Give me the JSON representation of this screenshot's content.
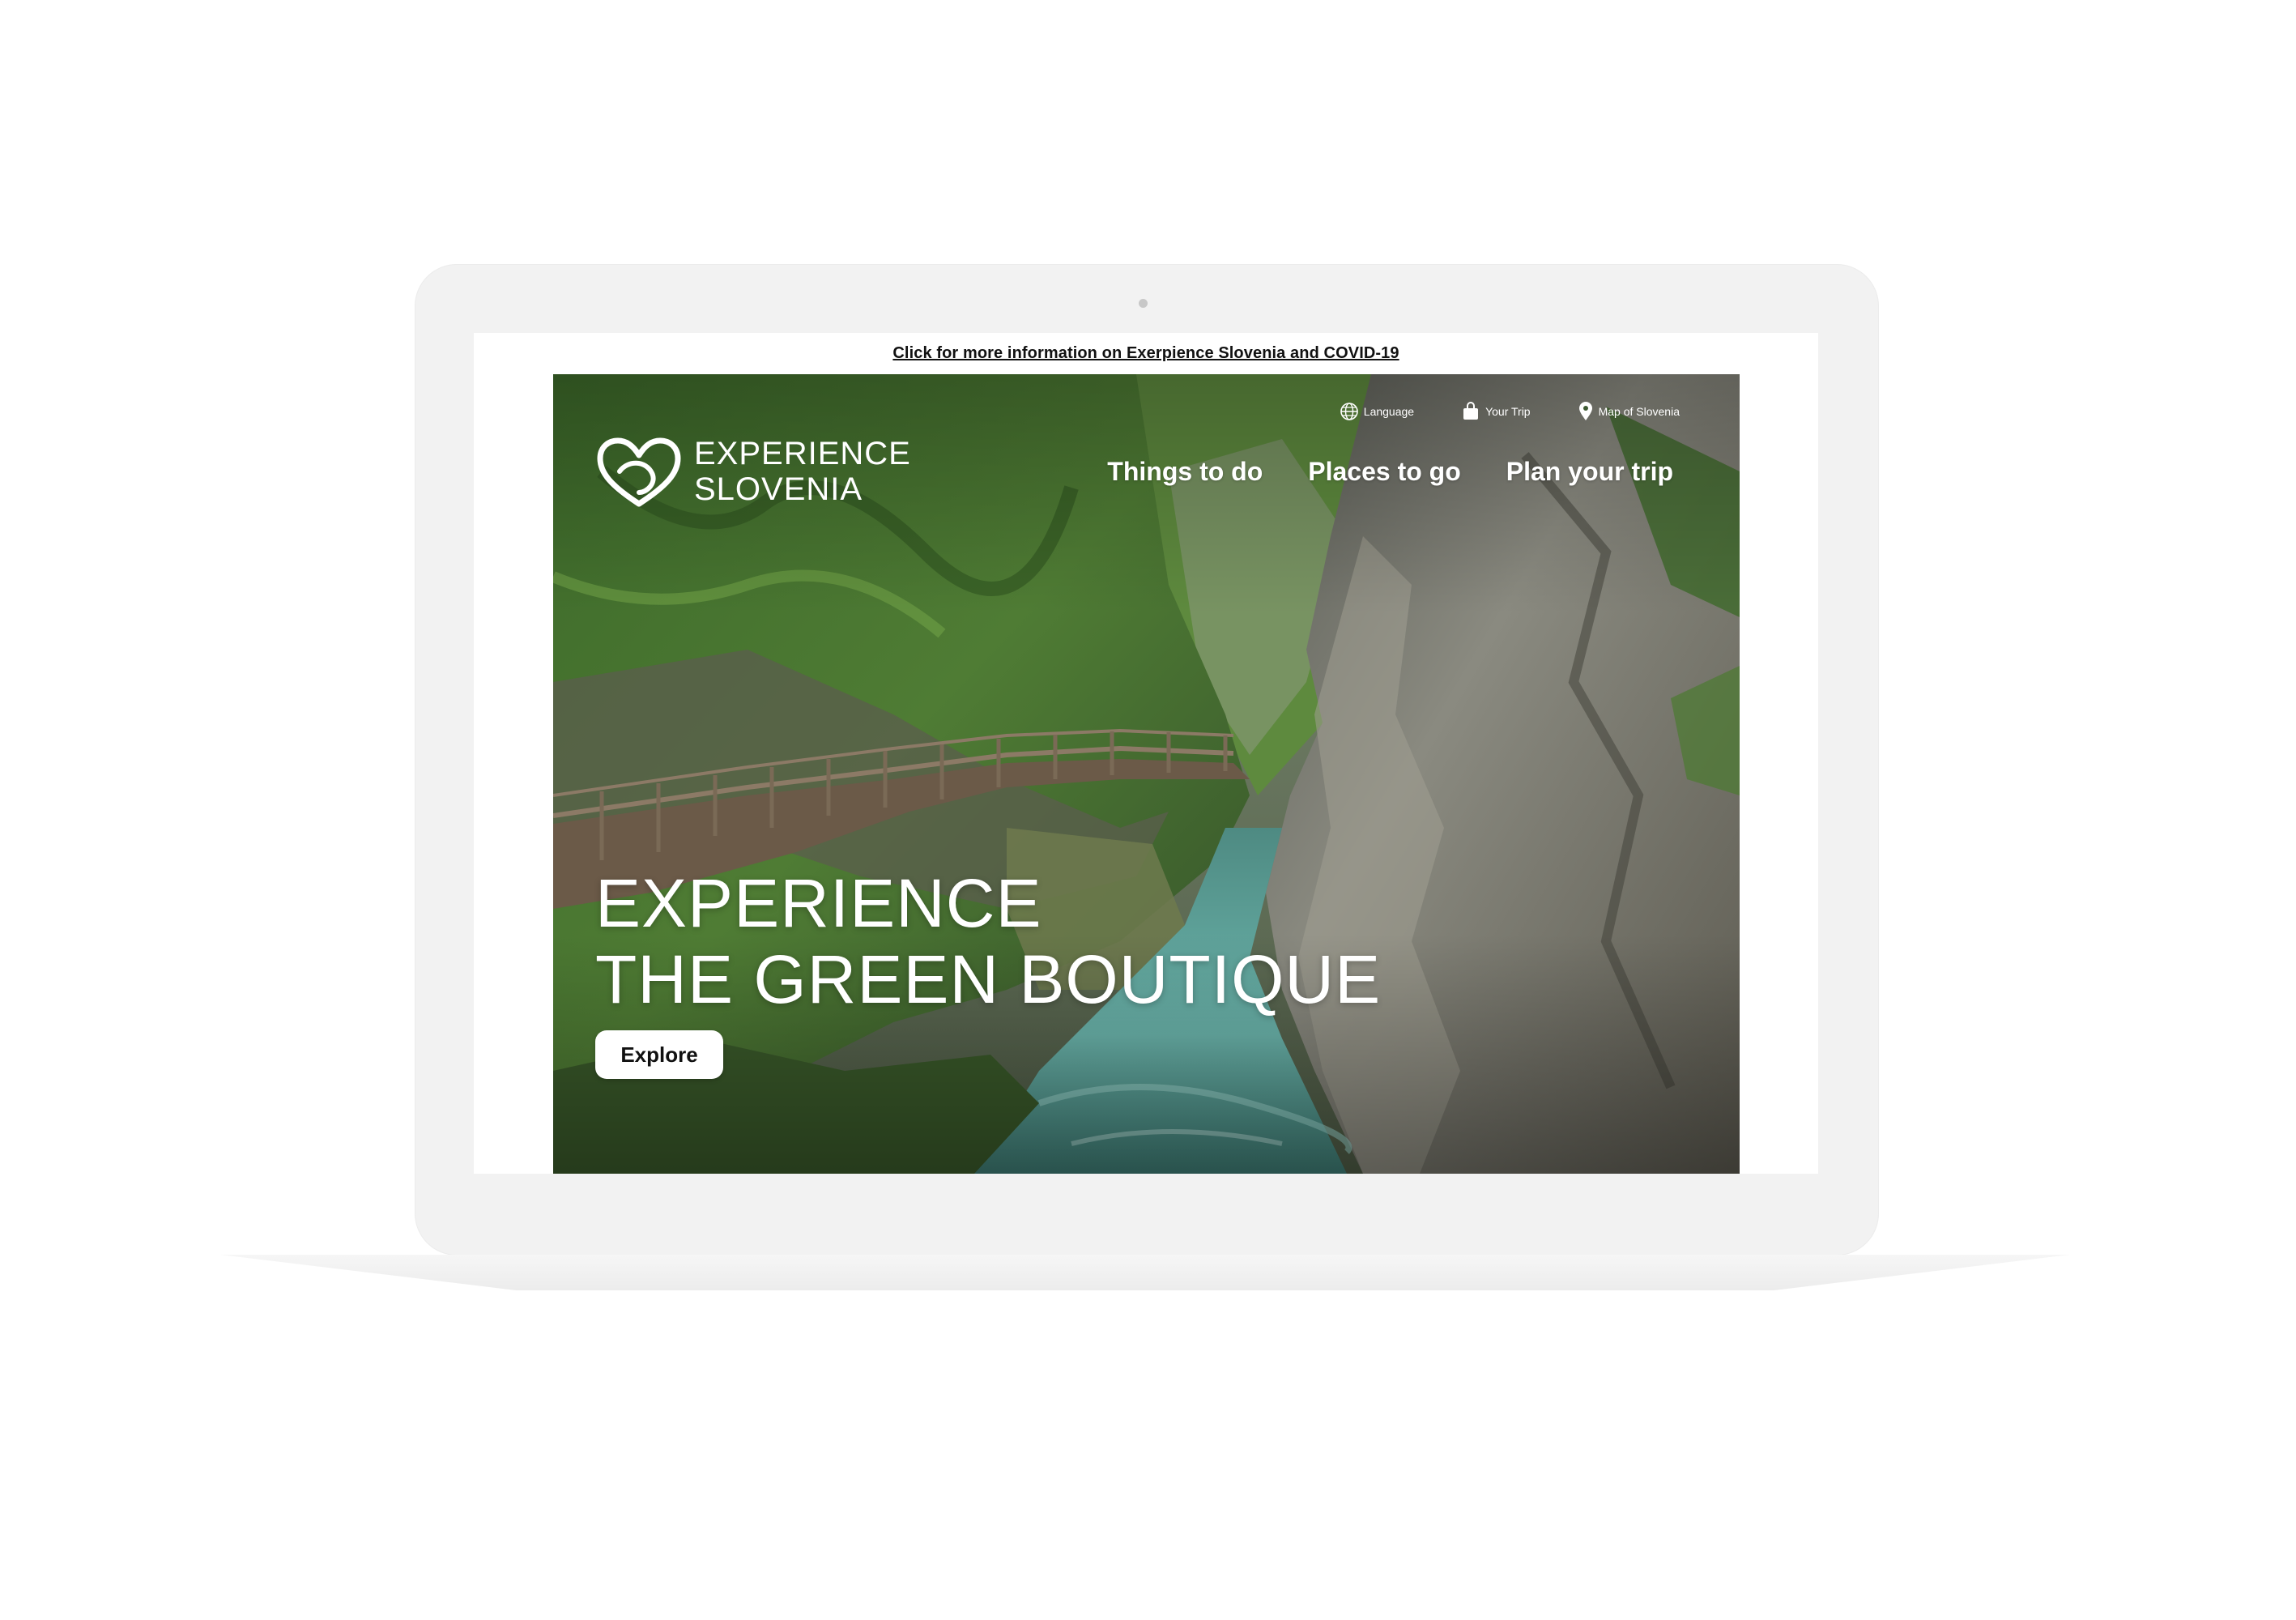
{
  "banner": {
    "text": "Click for more information on Exerpience Slovenia and COVID-19"
  },
  "logo": {
    "line1": "EXPERIENCE",
    "line2": "SLOVENIA",
    "icon": "heart-outline-logo"
  },
  "utility_nav": [
    {
      "label": "Language",
      "icon": "globe-icon"
    },
    {
      "label": "Your Trip",
      "icon": "bag-icon"
    },
    {
      "label": "Map of Slovenia",
      "icon": "map-pin-icon"
    }
  ],
  "main_nav": [
    {
      "label": "Things to do"
    },
    {
      "label": "Places to go"
    },
    {
      "label": "Plan your trip"
    }
  ],
  "hero": {
    "headline_line1": "EXPERIENCE",
    "headline_line2": "THE GREEN BOUTIQUE",
    "cta_label": "Explore",
    "scene": "gorge with wooden boardwalk over turquoise river"
  },
  "colors": {
    "text_on_hero": "#ffffff",
    "button_bg": "#ffffff",
    "button_text": "#111111",
    "device_frame": "#f2f2f2",
    "river": "#5fa8a0",
    "foliage": "#3f7a2c"
  }
}
